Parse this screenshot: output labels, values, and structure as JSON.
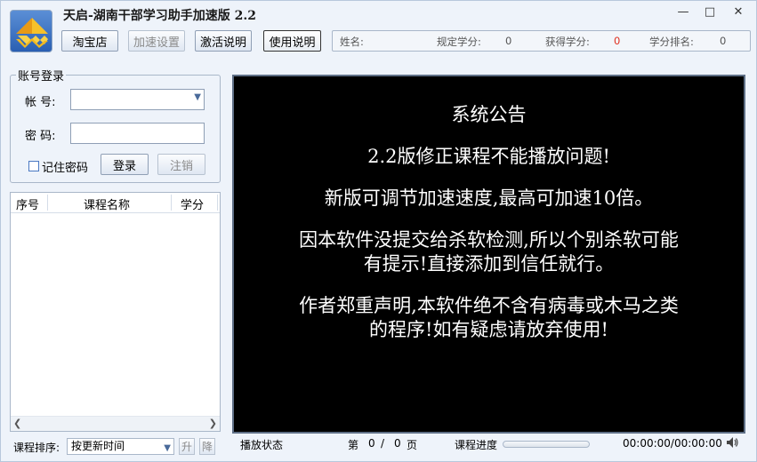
{
  "app": {
    "title": "天启-湖南干部学习助手加速版 2.2"
  },
  "window_controls": {
    "minimize": "—",
    "maximize": "□",
    "close": "✕"
  },
  "toolbar": {
    "taobao": "淘宝店",
    "speed_settings": "加速设置",
    "activation_help": "激活说明",
    "usage_help": "使用说明"
  },
  "info_bar": {
    "name_label": "姓名:",
    "required_credits_label": "规定学分:",
    "required_credits_value": "0",
    "earned_credits_label": "获得学分:",
    "earned_credits_value": "0",
    "rank_label": "学分排名:",
    "rank_value": "0"
  },
  "login": {
    "legend": "账号登录",
    "account_label": "帐  号:",
    "account_value": "",
    "password_label": "密  码:",
    "password_value": "",
    "remember_label": "记住密码",
    "login_button": "登录",
    "logout_button": "注销"
  },
  "course_list": {
    "columns": [
      "序号",
      "课程名称",
      "学分"
    ],
    "rows": []
  },
  "sort": {
    "label": "课程排序:",
    "selected": "按更新时间",
    "asc": "升",
    "desc": "降"
  },
  "notice": {
    "lines": [
      "系统公告",
      "2.2版修正课程不能播放问题!",
      "新版可调节加速速度,最高可加速10倍。",
      "因本软件没提交给杀软检测,所以个别杀软可能",
      "有提示!直接添加到信任就行。",
      "作者郑重声明,本软件绝不含有病毒或木马之类",
      "的程序!如有疑虑请放弃使用!"
    ]
  },
  "status": {
    "play_status_label": "播放状态",
    "page_prefix": "第",
    "page_current": "0",
    "page_sep": "/",
    "page_total": "0",
    "page_suffix": "页",
    "progress_label": "课程进度",
    "progress": 0,
    "time": "00:00:00/00:00:00"
  },
  "colors": {
    "accent": "#e03020",
    "player_bg": "#000000"
  }
}
